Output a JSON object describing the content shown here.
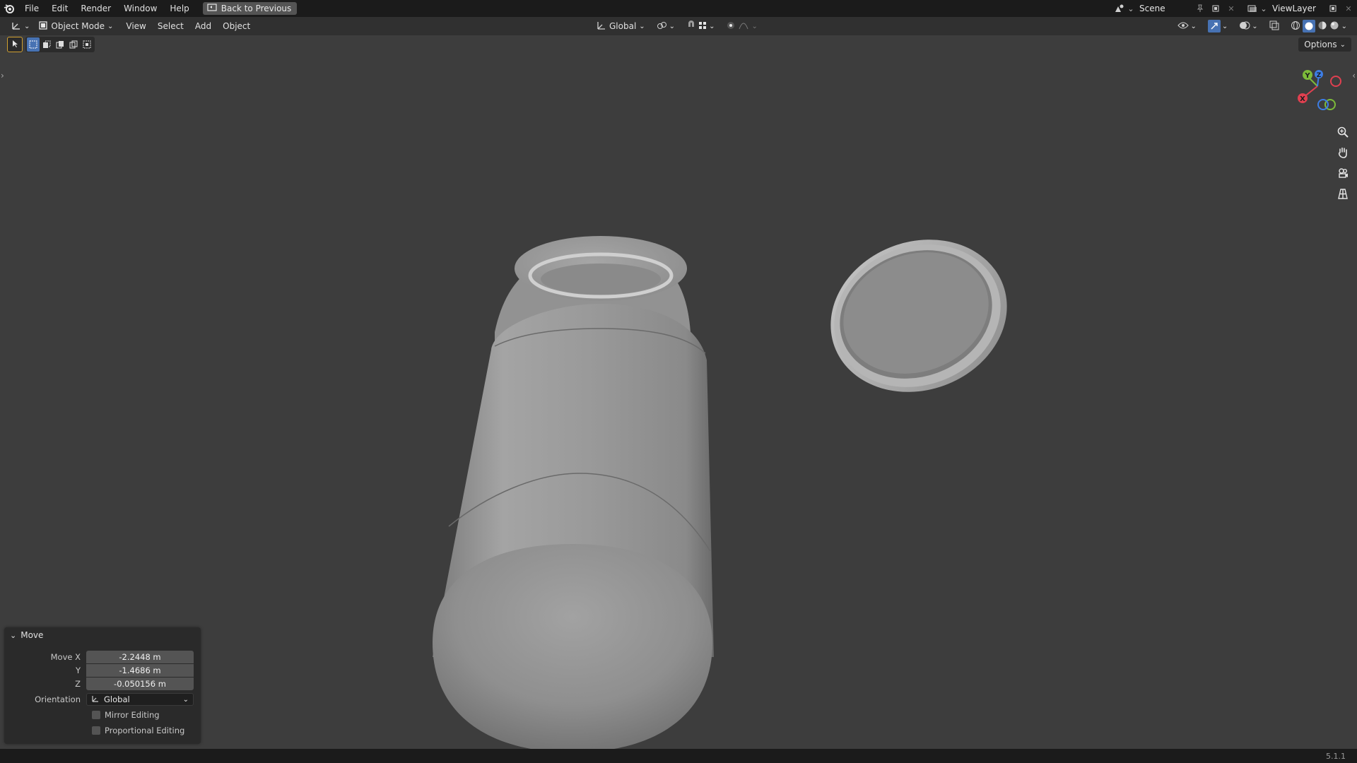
{
  "menu": {
    "file": "File",
    "edit": "Edit",
    "render": "Render",
    "window": "Window",
    "help": "Help",
    "back": "Back to Previous"
  },
  "top_right": {
    "scene": "Scene",
    "view_layer": "ViewLayer"
  },
  "header": {
    "mode": "Object Mode",
    "view": "View",
    "select": "Select",
    "add": "Add",
    "object": "Object",
    "orientation": "Global"
  },
  "options_label": "Options",
  "gizmo": {
    "x": "X",
    "y": "Y",
    "z": "Z"
  },
  "operator_panel": {
    "title": "Move",
    "move_x_label": "Move X",
    "move_x": "-2.2448 m",
    "y_label": "Y",
    "y": "-1.4686 m",
    "z_label": "Z",
    "z": "-0.050156 m",
    "orientation_label": "Orientation",
    "orientation": "Global",
    "mirror_editing": "Mirror Editing",
    "proportional_editing": "Proportional Editing"
  },
  "version": "5.1.1",
  "colors": {
    "accent": "#4772b3",
    "x_axis": "#e04050",
    "y_axis": "#7dbb3a",
    "z_axis": "#3d7ee6"
  }
}
